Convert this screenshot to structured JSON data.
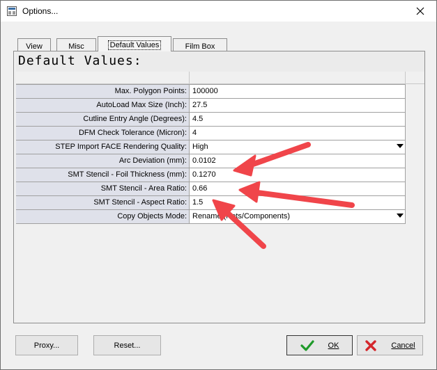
{
  "window": {
    "title": "Options..."
  },
  "tabs": [
    {
      "label": "View",
      "active": false
    },
    {
      "label": "Misc",
      "active": false
    },
    {
      "label": "Default Values",
      "active": true
    },
    {
      "label": "Film Box",
      "active": false
    }
  ],
  "panel": {
    "heading": "Default Values:"
  },
  "settings": [
    {
      "label": "Max. Polygon Points:",
      "value": "100000",
      "dropdown": false
    },
    {
      "label": "AutoLoad Max Size (Inch):",
      "value": "27.5",
      "dropdown": false
    },
    {
      "label": "Cutline Entry Angle (Degrees):",
      "value": "4.5",
      "dropdown": false
    },
    {
      "label": "DFM Check Tolerance (Micron):",
      "value": "4",
      "dropdown": false
    },
    {
      "label": "STEP Import FACE Rendering Quality:",
      "value": "High",
      "dropdown": true
    },
    {
      "label": "Arc Deviation (mm):",
      "value": "0.0102",
      "dropdown": false
    },
    {
      "label": "SMT Stencil - Foil Thickness (mm):",
      "value": "0.1270",
      "dropdown": false
    },
    {
      "label": "SMT Stencil - Area Ratio:",
      "value": "0.66",
      "dropdown": false
    },
    {
      "label": "SMT Stencil - Aspect Ratio:",
      "value": "1.5",
      "dropdown": false
    },
    {
      "label": "Copy Objects Mode:",
      "value": "Rename (Nets/Components)",
      "dropdown": true
    }
  ],
  "buttons": {
    "proxy": "Proxy...",
    "reset": "Reset...",
    "ok": "OK",
    "cancel": "Cancel"
  },
  "icons": {
    "ok": "checkmark-icon",
    "cancel": "red-x-icon",
    "close": "close-icon"
  },
  "colors": {
    "annotation_arrow": "#f0454a",
    "label_background": "#dfe1ea",
    "ok_check": "#1f9a2a",
    "cancel_x": "#d4262b"
  }
}
